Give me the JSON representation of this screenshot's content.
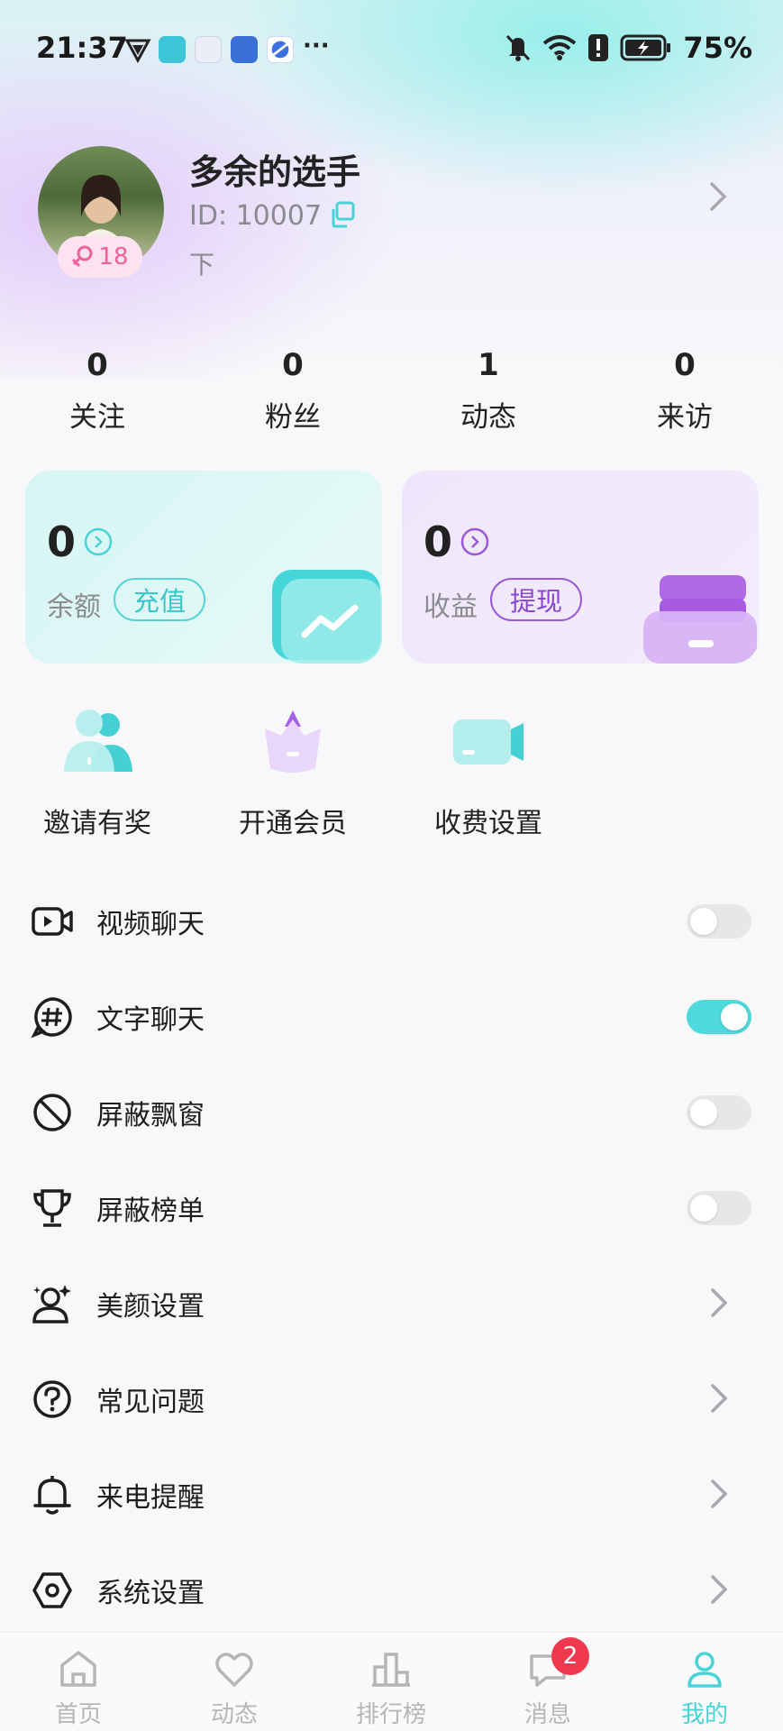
{
  "status_bar": {
    "time": "21:37",
    "more": "···",
    "battery_text": "75%",
    "icons": [
      "vpn-icon",
      "reader-app-icon",
      "app-icon",
      "app-icon",
      "browser-app-icon",
      "mute-icon",
      "wifi-icon",
      "alert-icon",
      "battery-charging-icon"
    ]
  },
  "profile": {
    "name": "多余的选手",
    "id": "ID: 10007",
    "subtitle": "下",
    "age": "18",
    "gender_color": "#f0609c"
  },
  "stats": [
    {
      "value": "0",
      "label": "关注"
    },
    {
      "value": "0",
      "label": "粉丝"
    },
    {
      "value": "1",
      "label": "动态"
    },
    {
      "value": "0",
      "label": "来访"
    }
  ],
  "wallet": {
    "balance": {
      "value": "0",
      "label": "余额",
      "button": "充值",
      "color": "#39c7c7"
    },
    "income": {
      "value": "0",
      "label": "收益",
      "button": "提现",
      "color": "#8a46cf"
    }
  },
  "quick_actions": [
    {
      "label": "邀请有奖",
      "icon": "invite-users-icon"
    },
    {
      "label": "开通会员",
      "icon": "vip-crown-icon"
    },
    {
      "label": "收费设置",
      "icon": "video-fee-icon"
    }
  ],
  "settings": [
    {
      "label": "视频聊天",
      "icon": "video-camera-icon",
      "type": "toggle",
      "on": false
    },
    {
      "label": "文字聊天",
      "icon": "hashtag-chat-icon",
      "type": "toggle",
      "on": true
    },
    {
      "label": "屏蔽飘窗",
      "icon": "block-icon",
      "type": "toggle",
      "on": false
    },
    {
      "label": "屏蔽榜单",
      "icon": "trophy-icon",
      "type": "toggle",
      "on": false
    },
    {
      "label": "美颜设置",
      "icon": "beauty-face-icon",
      "type": "link"
    },
    {
      "label": "常见问题",
      "icon": "question-icon",
      "type": "link"
    },
    {
      "label": "来电提醒",
      "icon": "bell-icon",
      "type": "link"
    },
    {
      "label": "系统设置",
      "icon": "settings-hex-icon",
      "type": "link"
    }
  ],
  "tabs": [
    {
      "label": "首页",
      "icon": "home-icon",
      "active": false
    },
    {
      "label": "动态",
      "icon": "heart-icon",
      "active": false
    },
    {
      "label": "排行榜",
      "icon": "ranking-icon",
      "active": false
    },
    {
      "label": "消息",
      "icon": "message-icon",
      "active": false,
      "badge": "2"
    },
    {
      "label": "我的",
      "icon": "profile-icon",
      "active": true
    }
  ],
  "accent_color": "#48d3d8"
}
